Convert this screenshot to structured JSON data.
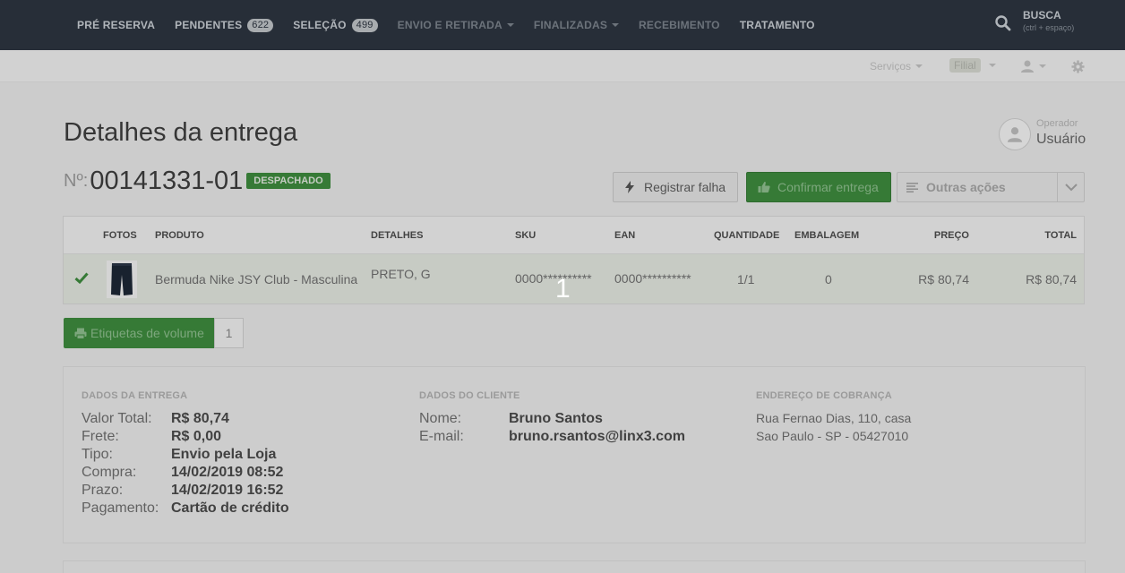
{
  "nav": {
    "items": [
      {
        "label": "PRÉ RESERVA",
        "badge": null,
        "caret": false,
        "dim": false
      },
      {
        "label": "PENDENTES",
        "badge": "622",
        "caret": false,
        "dim": false
      },
      {
        "label": "SELEÇÃO",
        "badge": "499",
        "caret": false,
        "dim": false
      },
      {
        "label": "ENVIO E RETIRADA",
        "badge": null,
        "caret": true,
        "dim": true
      },
      {
        "label": "FINALIZADAS",
        "badge": null,
        "caret": true,
        "dim": true
      },
      {
        "label": "RECEBIMENTO",
        "badge": null,
        "caret": false,
        "dim": true
      },
      {
        "label": "TRATAMENTO",
        "badge": null,
        "caret": false,
        "dim": false
      }
    ],
    "search_title": "BUSCA",
    "search_hint": "(ctrl + espaço)"
  },
  "subbar": {
    "services_label": "Serviços",
    "filial_label": "Filial"
  },
  "page": {
    "title": "Detalhes da entrega",
    "operator_label": "Operador",
    "operator_name": "Usuário",
    "number_label": "Nº:",
    "number_value": "00141331-01",
    "status": "DESPACHADO"
  },
  "actions": {
    "register_fail": "Registrar falha",
    "confirm_delivery": "Confirmar entrega",
    "other_actions": "Outras ações"
  },
  "table": {
    "headers": {
      "photos": "FOTOS",
      "product": "PRODUTO",
      "details": "DETALHES",
      "sku": "SKU",
      "ean": "EAN",
      "quantity": "QUANTIDADE",
      "packaging": "EMBALAGEM",
      "price": "PREÇO",
      "total": "TOTAL"
    },
    "rows": [
      {
        "product": "Bermuda Nike JSY Club - Masculina",
        "details": "PRETO, G",
        "sku": "0000**********",
        "ean": "0000**********",
        "quantity": "1/1",
        "packaging": "0",
        "price": "R$ 80,74",
        "total": "R$ 80,74"
      }
    ]
  },
  "center_marker": "1",
  "volume": {
    "label": "Etiquetas de volume",
    "count": "1"
  },
  "delivery": {
    "title": "DADOS DA ENTREGA",
    "fields": [
      {
        "k": "Valor Total:",
        "v": "R$ 80,74"
      },
      {
        "k": "Frete:",
        "v": "R$ 0,00"
      },
      {
        "k": "Tipo:",
        "v": "Envio pela Loja"
      },
      {
        "k": "Compra:",
        "v": "14/02/2019 08:52"
      },
      {
        "k": "Prazo:",
        "v": "14/02/2019 16:52"
      },
      {
        "k": "Pagamento:",
        "v": "Cartão de crédito"
      }
    ]
  },
  "customer": {
    "title": "DADOS DO CLIENTE",
    "fields": [
      {
        "k": "Nome:",
        "v": "Bruno Santos"
      },
      {
        "k": "E-mail:",
        "v": "bruno.rsantos@linx3.com"
      }
    ]
  },
  "billing": {
    "title": "ENDEREÇO DE COBRANÇA",
    "line1": "Rua Fernao Dias, 110, casa",
    "line2": "Sao Paulo - SP - 05427010"
  },
  "colors": {
    "nav_bg": "#2d3540",
    "success": "#3e8b3e"
  }
}
